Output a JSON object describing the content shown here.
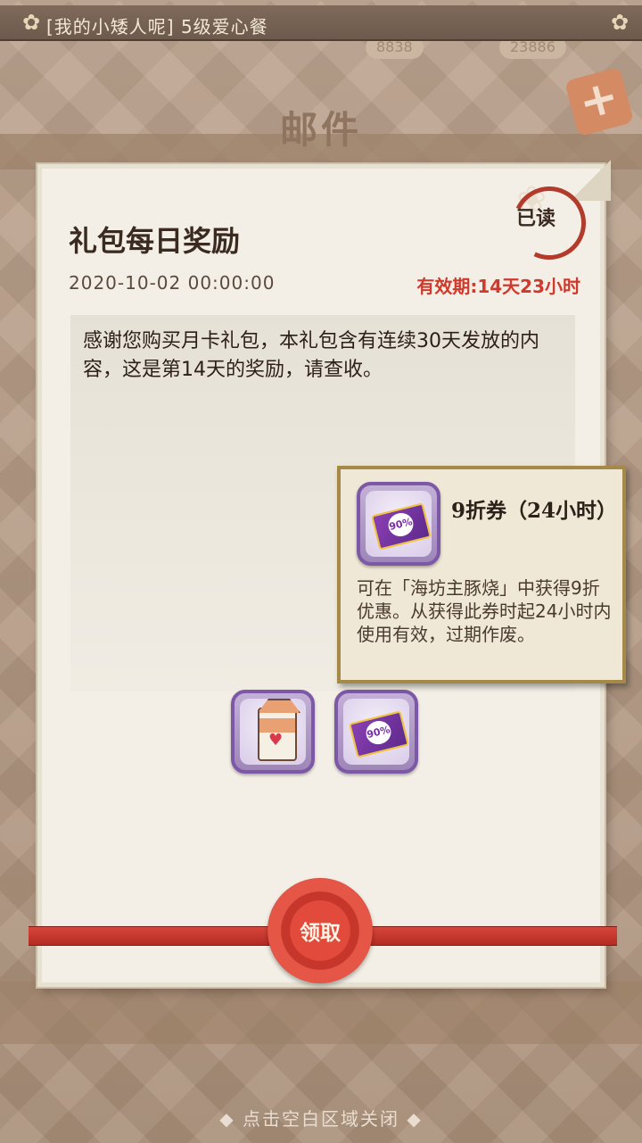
{
  "notification": {
    "text": "[我的小矮人呢] 5级爱心餐"
  },
  "background": {
    "title": "邮件",
    "counter_left": "8838",
    "counter_right": "23886"
  },
  "mail": {
    "title": "礼包每日奖励",
    "read_status": "已读",
    "date": "2020-10-02 00:00:00",
    "expiry": "有效期:14天23小时",
    "body": "感谢您购买月卡礼包，本礼包含有连续30天发放的内容，这是第14天的奖励，请查收。"
  },
  "rewards": [
    {
      "icon": "milk-carton-icon"
    },
    {
      "icon": "discount-coupon-icon",
      "badge": "90%"
    }
  ],
  "tooltip": {
    "name": "9折券（24小时）",
    "badge": "90%",
    "description": "可在「海坊主豚烧」中获得9折优惠。从获得此券时起24小时内使用有效，过期作废。"
  },
  "claim_button": {
    "label": "领取"
  },
  "close_hint": "◆ 点击空白区域关闭 ◆",
  "colors": {
    "accent_red": "#d0392b",
    "rarity_purple": "#7c58a6"
  }
}
